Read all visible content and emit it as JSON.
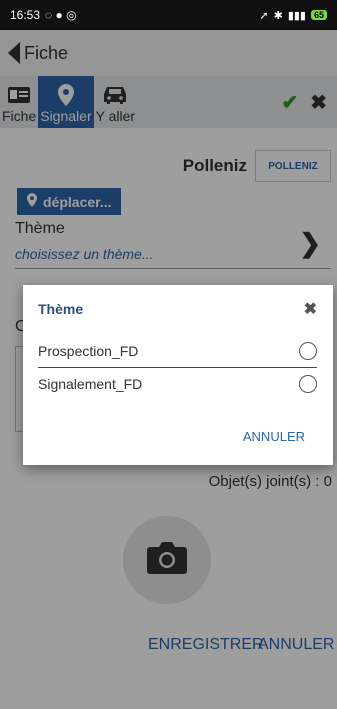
{
  "status_bar": {
    "time": "16:53",
    "battery": "65"
  },
  "app_bar": {
    "title": "Fiche"
  },
  "tabs": [
    {
      "label": "Fiche",
      "icon": "id-card-icon"
    },
    {
      "label": "Signaler",
      "icon": "map-marker-icon",
      "active": true
    },
    {
      "label": "Y aller",
      "icon": "car-icon"
    }
  ],
  "actions": {
    "confirm_icon": "check-icon",
    "close_icon": "close-icon"
  },
  "form": {
    "organization": "Polleniz",
    "logo_text": "POLLENIZ",
    "move_button": "déplacer...",
    "theme_label": "Thème",
    "theme_placeholder": "choisissez un thème...",
    "field_letter": "C",
    "attachments": "Objet(s) joint(s) : 0",
    "save_button": "ENREGISTRER",
    "cancel_button": "ANNULER"
  },
  "dialog": {
    "title": "Thème",
    "options": [
      {
        "label": "Prospection_FD",
        "selected": false
      },
      {
        "label": "Signalement_FD",
        "selected": false
      }
    ],
    "cancel_button": "ANNULER"
  },
  "colors": {
    "accent": "#2d64a8",
    "confirm": "#2d9a2d"
  }
}
